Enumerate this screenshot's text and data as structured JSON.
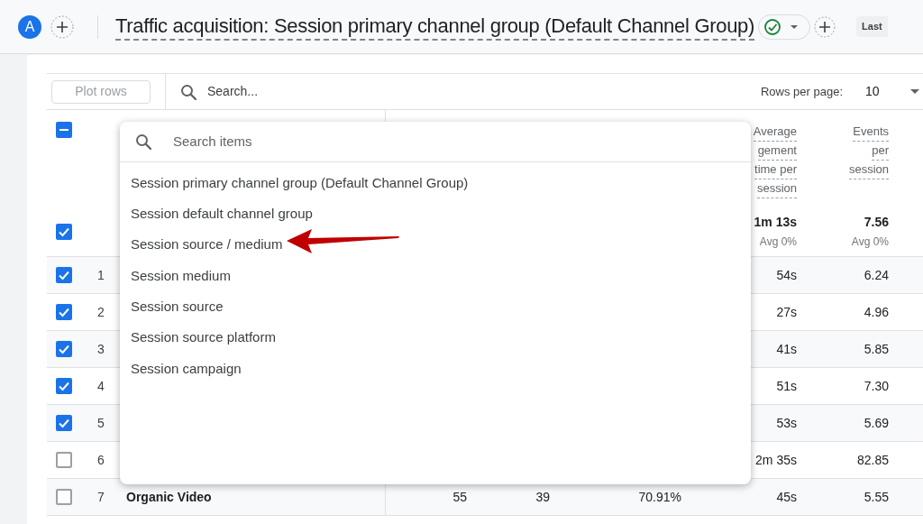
{
  "header": {
    "avatar": "A",
    "title": "Traffic acquisition: Session primary channel group (Default Channel Group)",
    "status_ok": true,
    "date_chip": "Last"
  },
  "toolbar": {
    "plot_rows": {
      "label": "Plot rows",
      "disabled": true
    },
    "search": {
      "placeholder": "Search..."
    },
    "rows_per_page_label": "Rows per page:",
    "rows_per_page": "10"
  },
  "table": {
    "select_all": {
      "indeterminate": true
    },
    "headers": [
      {
        "lines": [
          "Average",
          "gement",
          "time per",
          "session"
        ]
      },
      {
        "lines": [
          "Events",
          "per",
          "session"
        ]
      }
    ],
    "totals": {
      "checked": true,
      "cells": [
        {
          "value": "1m 13s",
          "note": "Avg 0%"
        },
        {
          "value": "7.56",
          "note": "Avg 0%"
        }
      ]
    },
    "rows": [
      {
        "number": "1",
        "checked": true,
        "values": {
          "column_4": "54s",
          "column_5": "6.24"
        }
      },
      {
        "number": "2",
        "checked": true,
        "values": {
          "column_4": "27s",
          "column_5": "4.96"
        }
      },
      {
        "number": "3",
        "checked": true,
        "values": {
          "column_4": "41s",
          "column_5": "5.85"
        }
      },
      {
        "number": "4",
        "checked": true,
        "values": {
          "column_4": "51s",
          "column_5": "7.30"
        }
      },
      {
        "number": "5",
        "checked": true,
        "values": {
          "column_4": "53s",
          "column_5": "5.69"
        }
      },
      {
        "number": "6",
        "checked": false,
        "values": {
          "column_4": "2m 35s",
          "column_5": "82.85"
        }
      },
      {
        "number": "7",
        "checked": false,
        "values": {
          "dimension": "Organic Video",
          "column_1": "55",
          "column_2": "39",
          "column_3": "70.91%",
          "column_4": "45s",
          "column_5": "5.55"
        }
      }
    ]
  },
  "dropdown": {
    "search": {
      "placeholder": "Search items"
    },
    "items": [
      "Session primary channel group (Default Channel Group)",
      "Session default channel group",
      "Session source / medium",
      "Session medium",
      "Session source",
      "Session source platform",
      "Session campaign"
    ]
  },
  "annotation": {
    "kind": "arrow"
  }
}
